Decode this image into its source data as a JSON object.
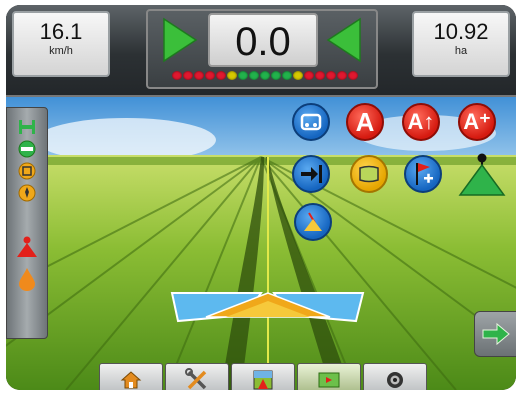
{
  "readouts": {
    "speed": {
      "value": "16.1",
      "unit": "km/h"
    },
    "area": {
      "value": "10.92",
      "unit": "ha"
    }
  },
  "guidance": {
    "cross_track_error": "0.0",
    "led_colors": [
      "#e0182f",
      "#e0182f",
      "#e0182f",
      "#e0182f",
      "#e0182f",
      "#d6c800",
      "#22b24c",
      "#22b24c",
      "#22b24c",
      "#22b24c",
      "#22b24c",
      "#d6c800",
      "#e0182f",
      "#e0182f",
      "#e0182f",
      "#e0182f",
      "#e0182f"
    ]
  },
  "guidance_modes": [
    {
      "id": "curved",
      "icon": "curve-guidance-icon",
      "color": "blue",
      "label": ""
    },
    {
      "id": "mark-a",
      "icon": "mark-a-icon",
      "color": "red",
      "label": "A"
    },
    {
      "id": "a-plus-nudge",
      "icon": "a-plus-nudge-icon",
      "color": "red",
      "label": "A↑"
    },
    {
      "id": "a-plus",
      "icon": "a-plus-icon",
      "color": "red",
      "label": "A⁺"
    },
    {
      "id": "next-pass",
      "icon": "next-pass-icon",
      "color": "blue",
      "label": ""
    },
    {
      "id": "boundary",
      "icon": "boundary-icon",
      "color": "yellow",
      "label": ""
    },
    {
      "id": "add-marker",
      "icon": "add-marker-icon",
      "color": "blue",
      "label": ""
    },
    {
      "id": "bar-view",
      "icon": "bar-view-icon",
      "color": "blue",
      "label": ""
    }
  ],
  "bottom_tabs": [
    {
      "id": "home",
      "icon": "home-icon"
    },
    {
      "id": "setup",
      "icon": "tools-icon"
    },
    {
      "id": "vehicle-view",
      "icon": "vehicle-view-icon"
    },
    {
      "id": "field-view",
      "icon": "field-view-icon"
    },
    {
      "id": "guidance-screen",
      "icon": "camera-icon"
    }
  ],
  "colors": {
    "accent_green": "#2fb34a",
    "accent_blue": "#1e7fd6",
    "accent_red": "#e3201a"
  }
}
